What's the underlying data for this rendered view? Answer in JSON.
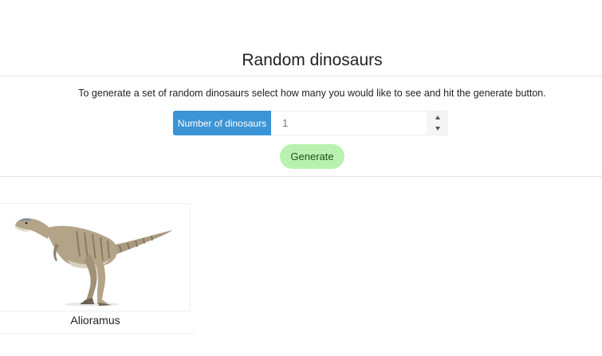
{
  "page": {
    "title": "Random dinosaurs",
    "instructions": "To generate a set of random dinosaurs select how many you would like to see and hit the generate button."
  },
  "form": {
    "label": "Number of dinosaurs",
    "value": "1",
    "generate_label": "Generate"
  },
  "results": [
    {
      "name": "Alioramus",
      "image": "dinosaur-illustration"
    }
  ],
  "colors": {
    "label_bg": "#3a94d6",
    "button_bg": "#b9f2b0"
  }
}
